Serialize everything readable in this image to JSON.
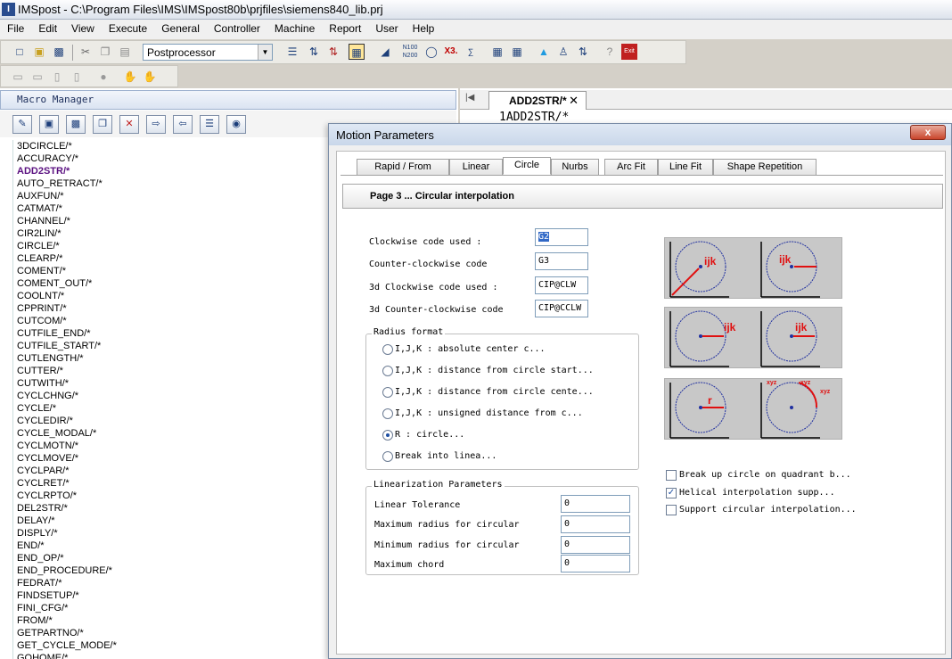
{
  "window": {
    "title": "IMSpost - C:\\Program Files\\IMS\\IMSpost80b\\prjfiles\\siemens840_lib.prj"
  },
  "menu": [
    "File",
    "Edit",
    "View",
    "Execute",
    "General",
    "Controller",
    "Machine",
    "Report",
    "User",
    "Help"
  ],
  "toolbar": {
    "postprocessor": "Postprocessor"
  },
  "left_panel": {
    "title": "Macro Manager",
    "macros": [
      "3DCIRCLE/*",
      "ACCURACY/*",
      "ADD2STR/*",
      "AUTO_RETRACT/*",
      "AUXFUN/*",
      "CATMAT/*",
      "CHANNEL/*",
      "CIR2LIN/*",
      "CIRCLE/*",
      "CLEARP/*",
      "COMENT/*",
      "COMENT_OUT/*",
      "COOLNT/*",
      "CPPRINT/*",
      "CUTCOM/*",
      "CUTFILE_END/*",
      "CUTFILE_START/*",
      "CUTLENGTH/*",
      "CUTTER/*",
      "CUTWITH/*",
      "CYCLCHNG/*",
      "CYCLE/*",
      "CYCLEDIR/*",
      "CYCLE_MODAL/*",
      "CYCLMOTN/*",
      "CYCLMOVE/*",
      "CYCLPAR/*",
      "CYCLRET/*",
      "CYCLRPTO/*",
      "DEL2STR/*",
      "DELAY/*",
      "DISPLY/*",
      "END/*",
      "END_OP/*",
      "END_PROCEDURE/*",
      "FEDRAT/*",
      "FINDSETUP/*",
      "FINI_CFG/*",
      "FROM/*",
      "GETPARTNO/*",
      "GET_CYCLE_MODE/*",
      "GOHOME/*"
    ],
    "selected": "ADD2STR/*"
  },
  "editor": {
    "tab": "ADD2STR/*",
    "line_no": "1",
    "code": "ADD2STR/*"
  },
  "dialog": {
    "title": "Motion Parameters",
    "close": "x",
    "tabs": [
      "Rapid / From",
      "Linear",
      "Circle",
      "Nurbs",
      "Arc Fit",
      "Line Fit",
      "Shape Repetition"
    ],
    "active_tab": "Circle",
    "page_header": "Page 3 ... Circular interpolation",
    "codes": [
      {
        "label": "Clockwise code used :",
        "value": "G2"
      },
      {
        "label": "Counter-clockwise code",
        "value": "G3"
      },
      {
        "label": "3d Clockwise code used :",
        "value": "CIP@CLW"
      },
      {
        "label": "3d Counter-clockwise code",
        "value": "CIP@CCLW"
      }
    ],
    "radius_format": {
      "title": "Radius format",
      "options": [
        "I,J,K : absolute center c...",
        "I,J,K : distance from circle start...",
        "I,J,K : distance from circle cente...",
        "I,J,K : unsigned distance from c...",
        "R : circle...",
        "Break into linea..."
      ],
      "selected_index": 4
    },
    "linearization": {
      "title": "Linearization Parameters",
      "fields": [
        {
          "label": "Linear Tolerance",
          "value": "0"
        },
        {
          "label": "Maximum radius for circular",
          "value": "0"
        },
        {
          "label": "Minimum radius for circular",
          "value": "0"
        },
        {
          "label": "Maximum chord",
          "value": "0"
        }
      ]
    },
    "diagram_labels": {
      "ijk": "ijk",
      "r": "r",
      "xyz": "xyz"
    },
    "checkboxes": [
      {
        "label": "Break up circle on quadrant b...",
        "checked": false
      },
      {
        "label": "Helical interpolation supp...",
        "checked": true
      },
      {
        "label": "Support circular interpolation...",
        "checked": false
      }
    ]
  }
}
